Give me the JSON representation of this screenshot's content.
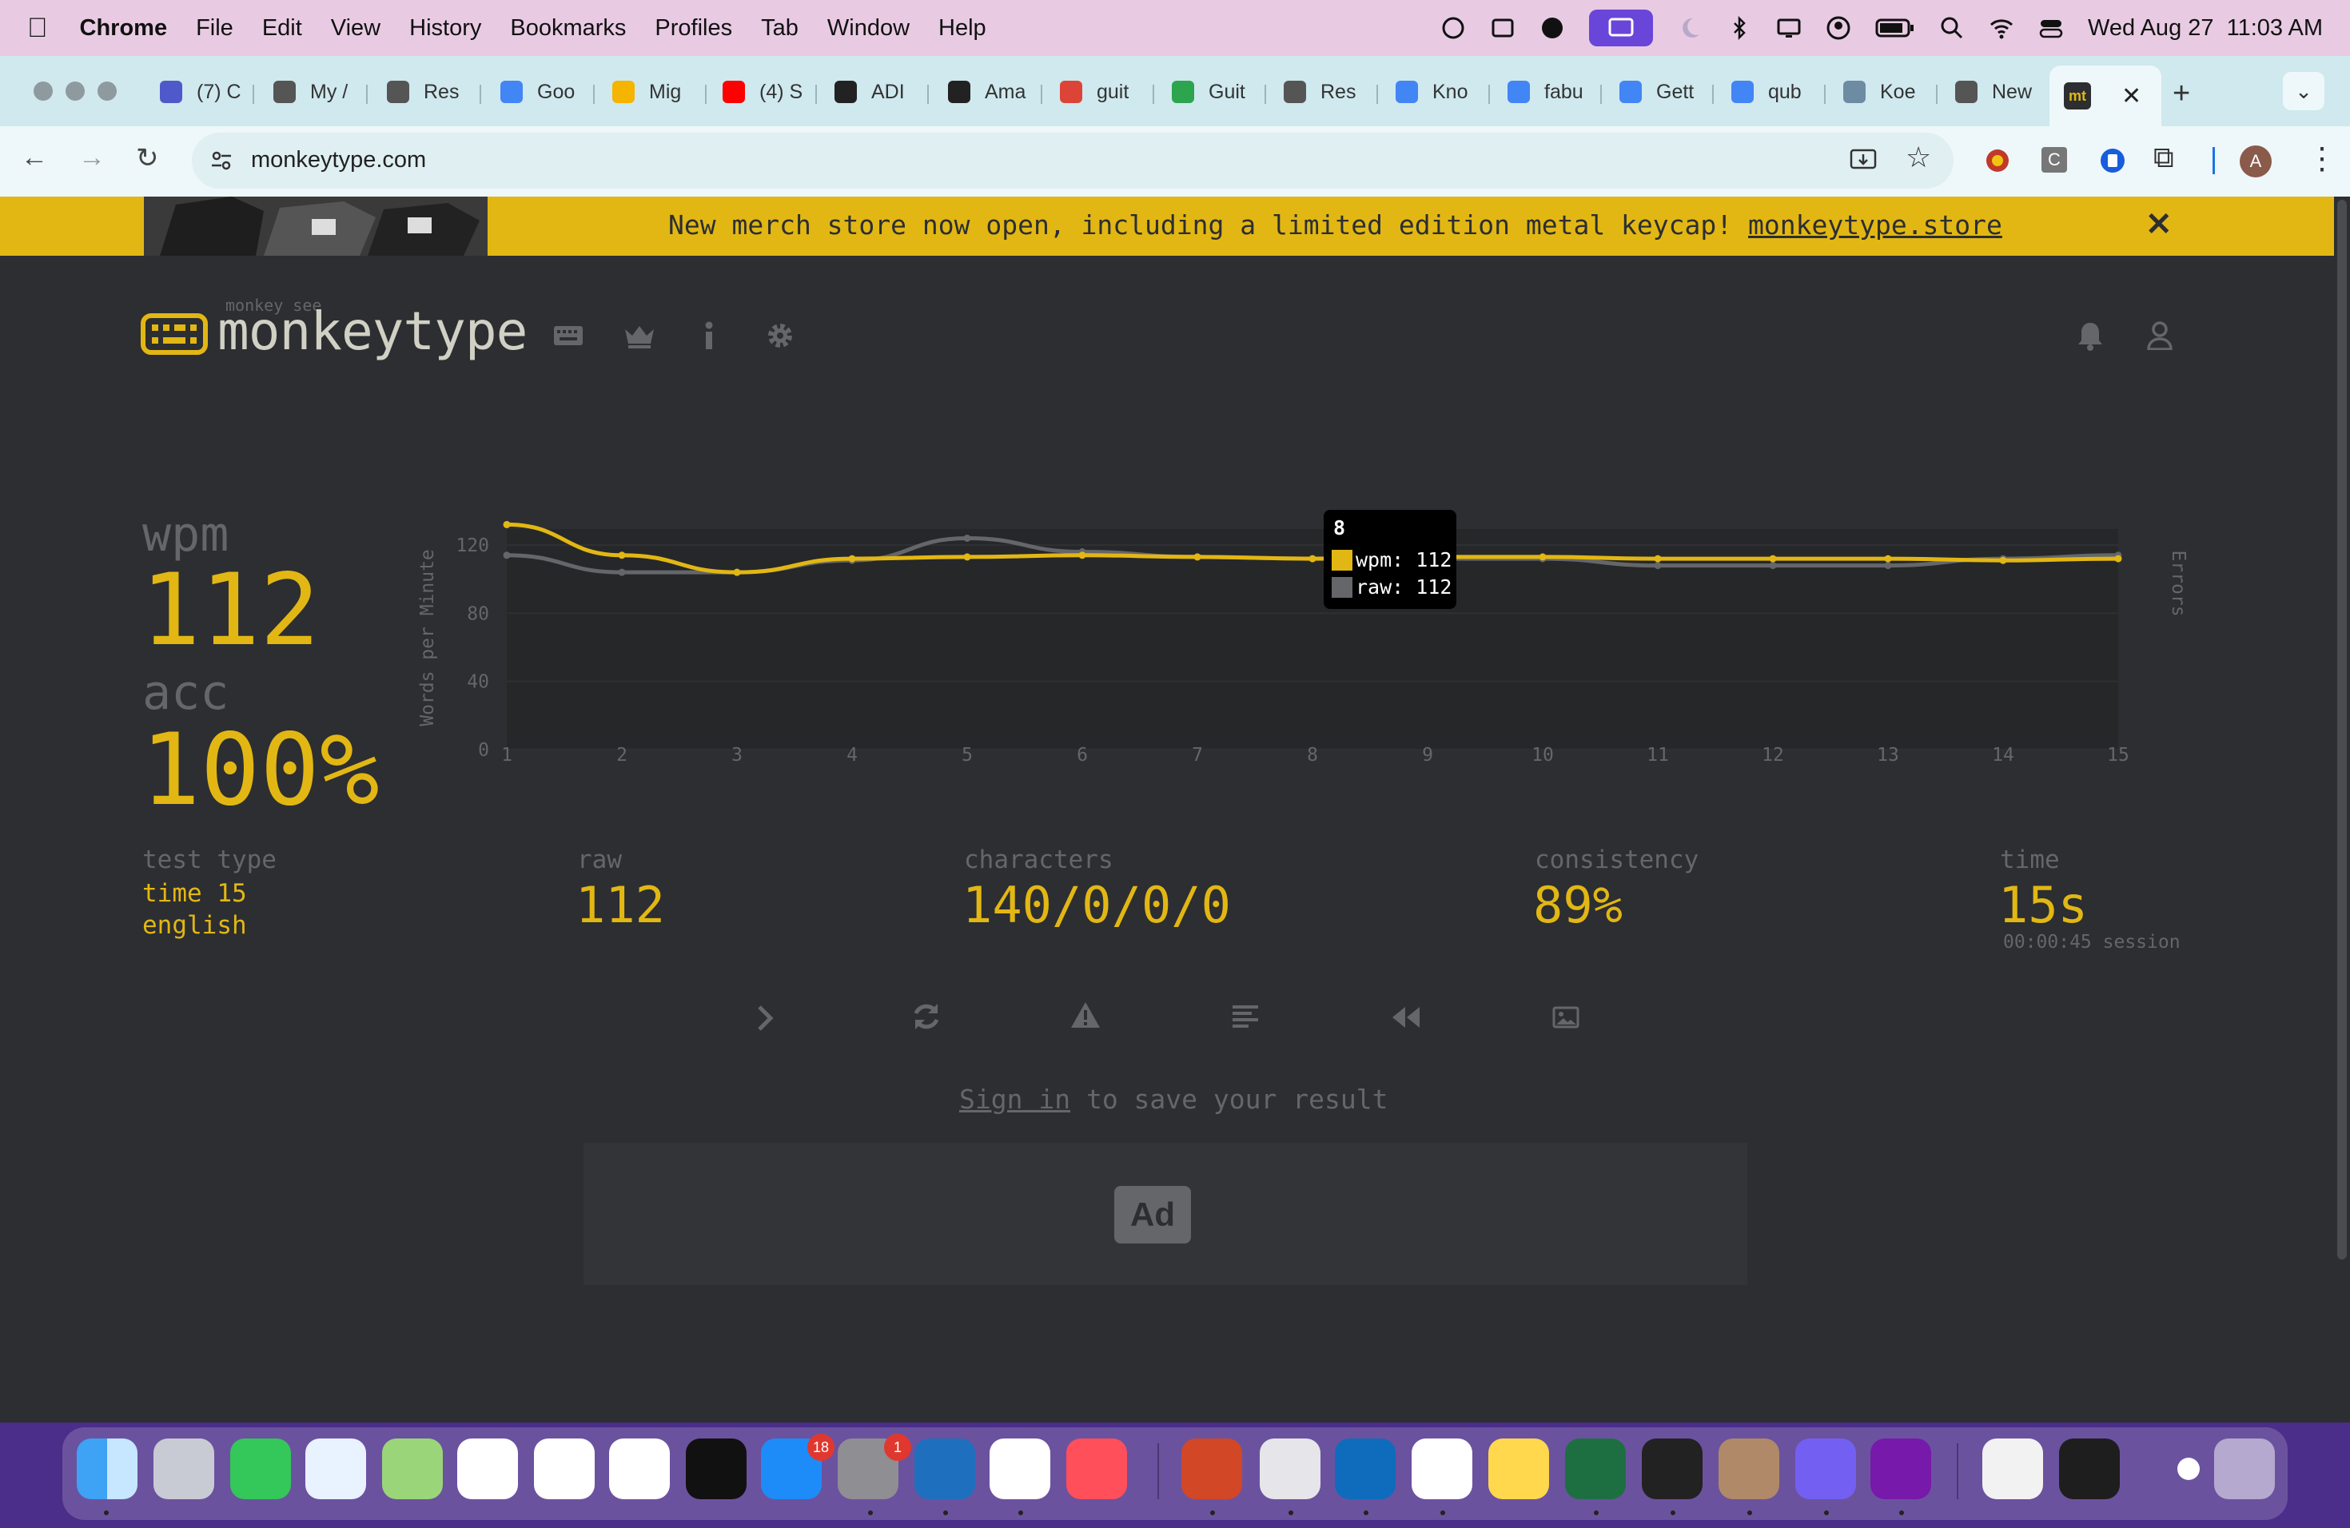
{
  "menubar": {
    "app": "Chrome",
    "items": [
      "File",
      "Edit",
      "View",
      "History",
      "Bookmarks",
      "Profiles",
      "Tab",
      "Window",
      "Help"
    ],
    "datetime": "Wed Aug 27  11:03 AM"
  },
  "tabs": [
    {
      "label": "(7) C",
      "color": "#5059c9"
    },
    {
      "label": "My /",
      "color": "#555555"
    },
    {
      "label": "Res",
      "color": "#555555"
    },
    {
      "label": "Goo",
      "color": "#4285f4"
    },
    {
      "label": "Mig",
      "color": "#f4b400"
    },
    {
      "label": "(4) S",
      "color": "#ff0000"
    },
    {
      "label": "ADI",
      "color": "#222222"
    },
    {
      "label": "Ama",
      "color": "#222222"
    },
    {
      "label": "guit",
      "color": "#db4437"
    },
    {
      "label": "Guit",
      "color": "#2da44e"
    },
    {
      "label": "Res",
      "color": "#555555"
    },
    {
      "label": "Kno",
      "color": "#4285f4"
    },
    {
      "label": "fabu",
      "color": "#4285f4"
    },
    {
      "label": "Gett",
      "color": "#4285f4"
    },
    {
      "label": "qub",
      "color": "#4285f4"
    },
    {
      "label": "Koe",
      "color": "#6d8ba3"
    },
    {
      "label": "New",
      "color": "#555555"
    },
    {
      "label": "mt",
      "color": "#e2b714"
    }
  ],
  "toolbar": {
    "url": "monkeytype.com",
    "profile_initial": "A",
    "ext_c": "C"
  },
  "banner": {
    "text": "New merch store now open, including a limited edition metal keycap! ",
    "link": "monkeytype.store",
    "close": "✕"
  },
  "logo": {
    "text": "monkeytype",
    "sub": "monkey see"
  },
  "result": {
    "wpm_label": "wpm",
    "wpm": "112",
    "acc_label": "acc",
    "acc": "100%",
    "test_type_label": "test type",
    "test_type_1": "time 15",
    "test_type_2": "english",
    "raw_label": "raw",
    "raw": "112",
    "characters_label": "characters",
    "characters": "140/0/0/0",
    "consistency_label": "consistency",
    "consistency": "89%",
    "time_label": "time",
    "time": "15s",
    "session": "00:00:45 session"
  },
  "tooltip": {
    "title": "8",
    "wpm": "wpm: 112",
    "raw": "raw: 112"
  },
  "signin": {
    "link": "Sign in",
    "rest": " to save your result"
  },
  "ad": {
    "label": "Ad"
  },
  "chart_data": {
    "type": "line",
    "x": [
      1,
      2,
      3,
      4,
      5,
      6,
      7,
      8,
      9,
      10,
      11,
      12,
      13,
      14,
      15
    ],
    "series": [
      {
        "name": "wpm",
        "color": "#e2b714",
        "values": [
          132,
          114,
          104,
          112,
          113,
          114,
          113,
          112,
          113,
          113,
          112,
          112,
          112,
          111,
          112
        ]
      },
      {
        "name": "raw",
        "color": "#646669",
        "values": [
          114,
          104,
          104,
          111,
          124,
          116,
          113,
          112,
          112,
          112,
          108,
          108,
          108,
          112,
          114
        ]
      }
    ],
    "ylabel": "Words per Minute",
    "y2label": "Errors",
    "yticks": [
      0,
      40,
      80,
      120
    ],
    "ylim": [
      0,
      120
    ]
  },
  "colors": {
    "bg": "#2c2e31",
    "main": "#e2b714",
    "sub": "#646669",
    "text": "#d1d0c5"
  }
}
